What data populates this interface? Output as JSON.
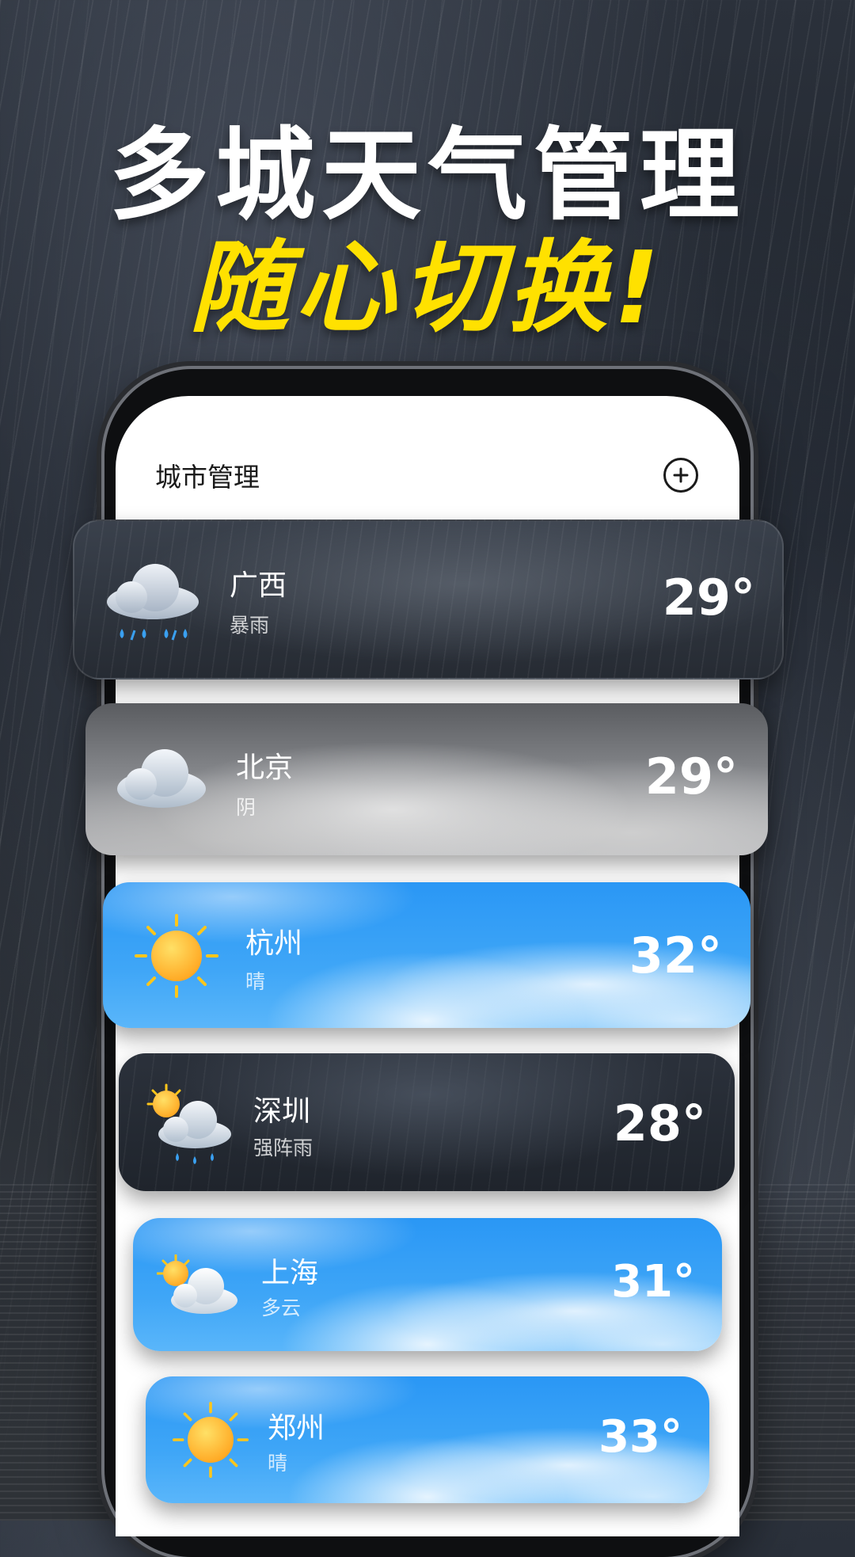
{
  "headline": {
    "line1": "多城天气管理",
    "line2": "随心切换!"
  },
  "screen": {
    "title": "城市管理",
    "add_icon": "plus-circle-icon"
  },
  "colors": {
    "headline_yellow": "#ffe100",
    "sunny_blue": "#2a97f5",
    "storm_dark": "#262b33"
  },
  "cities": [
    {
      "name": "广西",
      "condition": "暴雨",
      "temp": "29°",
      "icon": "heavy-rain-cloud-icon",
      "theme": "storm"
    },
    {
      "name": "北京",
      "condition": "阴",
      "temp": "29°",
      "icon": "overcast-cloud-icon",
      "theme": "cloudy"
    },
    {
      "name": "杭州",
      "condition": "晴",
      "temp": "32°",
      "icon": "sun-icon",
      "theme": "sunny"
    },
    {
      "name": "深圳",
      "condition": "强阵雨",
      "temp": "28°",
      "icon": "sun-cloud-rain-icon",
      "theme": "shower"
    },
    {
      "name": "上海",
      "condition": "多云",
      "temp": "31°",
      "icon": "sun-behind-cloud-icon",
      "theme": "sunny"
    },
    {
      "name": "郑州",
      "condition": "晴",
      "temp": "33°",
      "icon": "sun-icon",
      "theme": "sunny"
    }
  ]
}
